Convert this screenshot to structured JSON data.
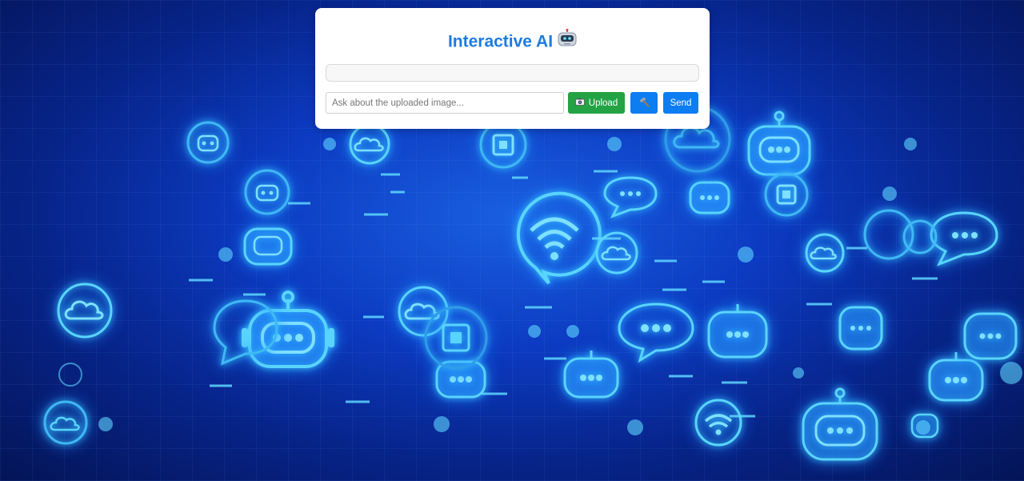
{
  "app": {
    "title": "Interactive AI",
    "title_icon": "robot-face-icon"
  },
  "chat": {
    "messages": []
  },
  "composer": {
    "placeholder": "Ask about the uploaded image...",
    "value": "",
    "upload_label": "Upload",
    "upload_icon": "camera-icon",
    "tool_icon": "hammer-icon",
    "send_label": "Send"
  },
  "colors": {
    "title": "#1e7be0",
    "upload": "#23a344",
    "primary": "#0d7df2",
    "background": "#0c3bc2"
  }
}
